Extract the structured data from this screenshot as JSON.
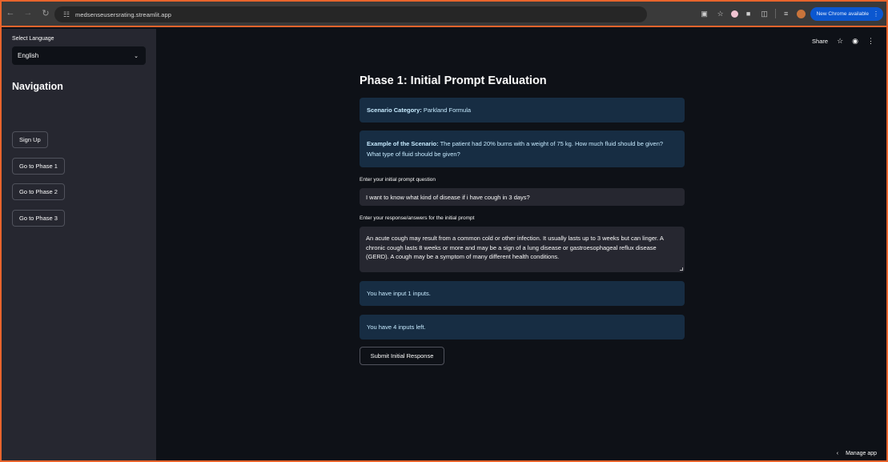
{
  "browser": {
    "url": "medsenseusersrating.streamlit.app",
    "update_label": "New Chrome available"
  },
  "sidebar": {
    "language_label": "Select Language",
    "language_value": "English",
    "nav_title": "Navigation",
    "buttons": [
      "Sign Up",
      "Go to Phase 1",
      "Go to Phase 2",
      "Go to Phase 3"
    ]
  },
  "header": {
    "share_label": "Share"
  },
  "main": {
    "title": "Phase 1: Initial Prompt Evaluation",
    "scenario_category_label": "Scenario Category:",
    "scenario_category_value": "Parkland Formula",
    "example_label": "Example of the Scenario:",
    "example_text": "The patient had 20% burns with a weight of 75 kg. How much fluid should be given? What type of fluid should be given?",
    "prompt_label": "Enter your initial prompt question",
    "prompt_value": "I want to know what kind of disease if i have cough in 3 days?",
    "response_label": "Enter your response/answers for the initial prompt",
    "response_value": "An acute cough may result from a common cold or other infection. It usually lasts up to 3 weeks but can linger. A chronic cough lasts 8 weeks or more and may be a sign of a lung disease or gastroesophageal reflux disease (GERD). A cough may be a symptom of many different health conditions.",
    "inputs_done": "You have input 1 inputs.",
    "inputs_left": "You have 4 inputs left.",
    "submit_label": "Submit Initial Response"
  },
  "footer": {
    "manage_label": "Manage app"
  }
}
